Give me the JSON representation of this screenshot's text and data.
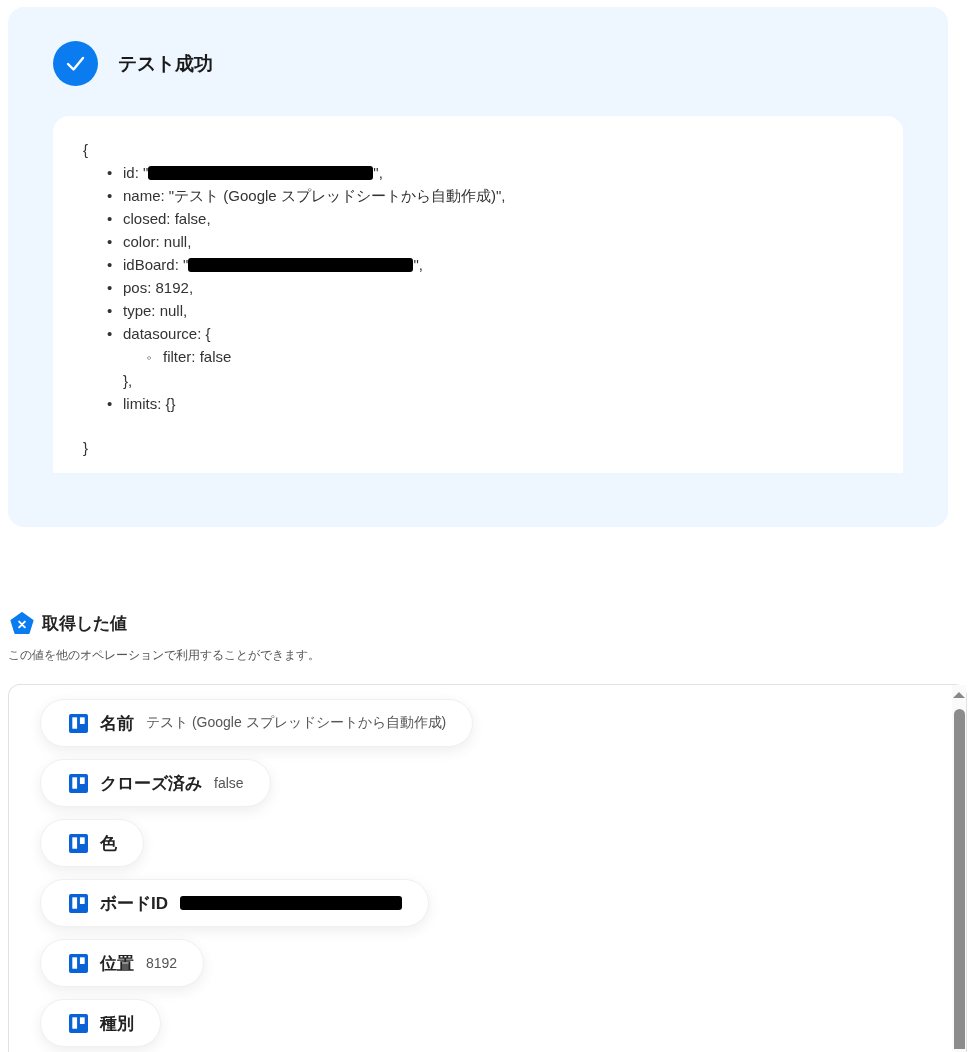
{
  "test_result": {
    "passed": true,
    "title": "テスト成功",
    "open": "{",
    "items": [
      {
        "marker": "•",
        "text": "id: \"",
        "redacted": true,
        "after": "\","
      },
      {
        "marker": "•",
        "text": "name: \"テスト (Google スプレッドシートから自動作成)\","
      },
      {
        "marker": "•",
        "text": "closed: false,"
      },
      {
        "marker": "•",
        "text": "color: null,"
      },
      {
        "marker": "•",
        "text": "idBoard: \"",
        "redacted": true,
        "after": "\","
      },
      {
        "marker": "•",
        "text": "pos: 8192,"
      },
      {
        "marker": "•",
        "text": "type: null,"
      },
      {
        "marker": "•",
        "text": "datasource: {",
        "children": [
          {
            "marker": "◦",
            "text": "filter: false"
          }
        ],
        "close": "},"
      },
      {
        "marker": "•",
        "text": "limits: {}"
      }
    ],
    "close": "}"
  },
  "values_section": {
    "title": "取得した値",
    "description": "この値を他のオペレーションで利用することができます。",
    "values": [
      {
        "label": "名前",
        "value": "テスト (Google スプレッドシートから自動作成)"
      },
      {
        "label": "クローズ済み",
        "value": "false"
      },
      {
        "label": "色"
      },
      {
        "label": "ボードID",
        "redacted": true
      },
      {
        "label": "位置",
        "value": "8192"
      },
      {
        "label": "種別"
      }
    ]
  }
}
